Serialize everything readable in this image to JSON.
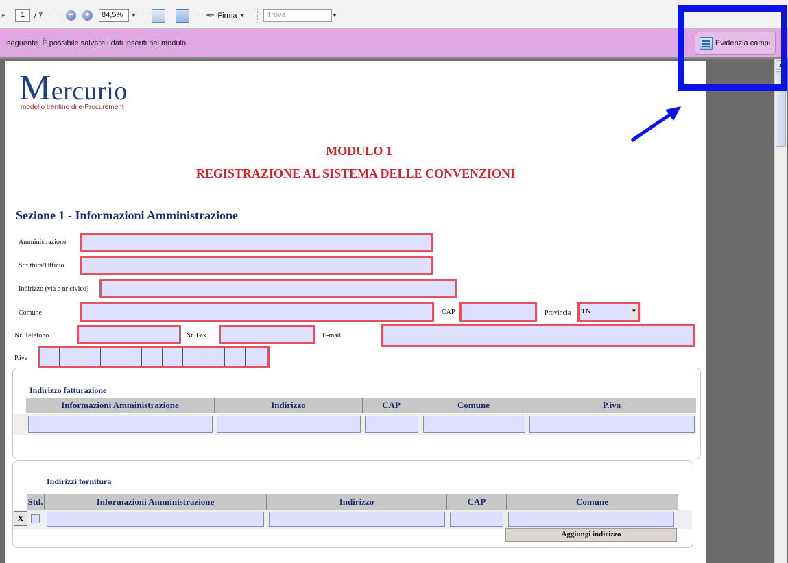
{
  "toolbar": {
    "page_current": "1",
    "page_total": "/ 7",
    "zoom_minus": "−",
    "zoom_plus": "+",
    "zoom_value": "84,5%",
    "firma_label": "Firma",
    "trova_placeholder": "Trova"
  },
  "infobar": {
    "text": "seguente. È possibile salvare i dati inseriti nel modulo.",
    "highlight_button_label": "Evidenzia campi"
  },
  "logo": {
    "name_initial": "M",
    "name_rest": "ercurio",
    "tagline": "modello trentino di e-Procurement"
  },
  "document": {
    "title1": "MODULO 1",
    "title2": "REGISTRAZIONE AL SISTEMA  DELLE CONVENZIONI",
    "section1_title": "Sezione 1 - Informazioni Amministrazione",
    "labels": {
      "amministrazione": "Amministrazione",
      "struttura": "Struttura/Ufficio",
      "indirizzo": "Indirizzo (via e nr civico)",
      "comune": "Comune",
      "cap": "CAP",
      "provincia": "Provincia",
      "telefono": "Nr. Telefono",
      "fax": "Nr. Fax",
      "email": "E-mail",
      "piva": "P.iva"
    },
    "provincia_value": "TN"
  },
  "fatturazione": {
    "title": "Indirizzo fatturazione",
    "columns": [
      "Informazioni Amministrazione",
      "Indirizzo",
      "CAP",
      "Comune",
      "P.iva"
    ]
  },
  "fornitura": {
    "title": "Indirizzi fornitura",
    "columns": [
      "Std.",
      "Informazioni Amministrazione",
      "Indirizzo",
      "CAP",
      "Comune"
    ],
    "remove_label": "X",
    "add_button_label": "Aggiungi indirizzo"
  },
  "colors": {
    "field_border": "#e0525f",
    "field_fill": "#dde0ff",
    "title_red": "#d62128",
    "heading_blue": "#1d2a6e",
    "infobar": "#dfa8e3",
    "annotation_blue": "#0a14e6"
  }
}
